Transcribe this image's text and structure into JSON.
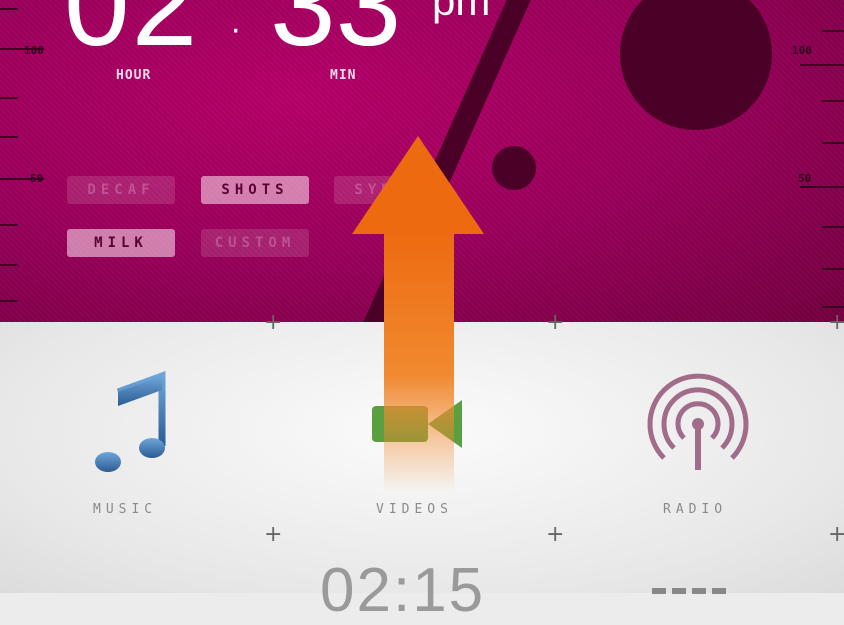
{
  "clock": {
    "hour": "02",
    "separator": "·",
    "minute": "33",
    "ampm": "pm",
    "hour_caption": "HOUR",
    "minute_caption": "MIN"
  },
  "ruler": {
    "left_labels": [
      "100",
      "50"
    ],
    "right_labels": [
      "100",
      "50"
    ]
  },
  "options": [
    {
      "label": "DECAF",
      "state": "off"
    },
    {
      "label": "SHOTS",
      "state": "on"
    },
    {
      "label": "SYRUP",
      "state": "off"
    },
    {
      "label": "MILK",
      "state": "on"
    },
    {
      "label": "CUSTOM",
      "state": "off"
    }
  ],
  "apps": [
    {
      "label": "MUSIC",
      "icon": "music-note-icon"
    },
    {
      "label": "VIDEOS",
      "icon": "video-camera-icon"
    },
    {
      "label": "RADIO",
      "icon": "radio-broadcast-icon"
    }
  ],
  "bottom_time": "02:15",
  "colors": {
    "top_bg": "#a00060",
    "accent_dark": "#4a0027",
    "arrow": "#ee6a10",
    "bottom_bg": "#ececec"
  }
}
